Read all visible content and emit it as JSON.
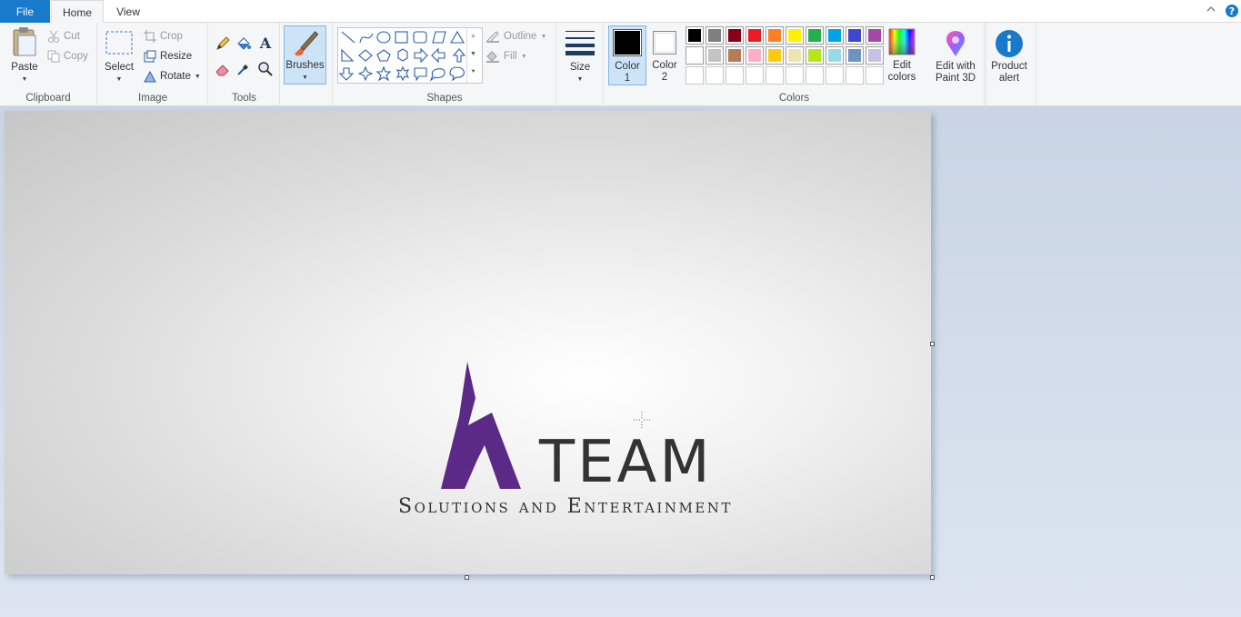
{
  "tabs": {
    "file": "File",
    "home": "Home",
    "view": "View"
  },
  "ribbon": {
    "clipboard": {
      "label": "Clipboard",
      "paste": "Paste",
      "cut": "Cut",
      "copy": "Copy"
    },
    "image": {
      "label": "Image",
      "select": "Select",
      "crop": "Crop",
      "resize": "Resize",
      "rotate": "Rotate"
    },
    "tools": {
      "label": "Tools"
    },
    "brushes": {
      "label": "Brushes"
    },
    "shapes": {
      "label": "Shapes",
      "outline": "Outline",
      "fill": "Fill"
    },
    "size": {
      "label": "Size"
    },
    "colors": {
      "label": "Colors",
      "color1_line1": "Color",
      "color1_line2": "1",
      "color2_line1": "Color",
      "color2_line2": "2",
      "edit_line1": "Edit",
      "edit_line2": "colors",
      "color1_value": "#000000",
      "color2_value": "#ffffff",
      "palette_row1": [
        "#000000",
        "#7f7f7f",
        "#880015",
        "#ed1c24",
        "#ff7f27",
        "#fff200",
        "#22b14c",
        "#00a2e8",
        "#3f48cc",
        "#a349a4"
      ],
      "palette_row2": [
        "#ffffff",
        "#c3c3c3",
        "#b97a57",
        "#ffaec9",
        "#ffc90e",
        "#efe4b0",
        "#b5e61d",
        "#99d9ea",
        "#7092be",
        "#c8bfe7"
      ]
    },
    "paint3d": {
      "line1": "Edit with",
      "line2": "Paint 3D"
    },
    "alert": {
      "line1": "Product",
      "line2": "alert"
    }
  },
  "canvas": {
    "logo_word": "TEAM",
    "logo_tagline": "Solutions and Entertainment",
    "logo_brand_color": "#5b2a86"
  }
}
